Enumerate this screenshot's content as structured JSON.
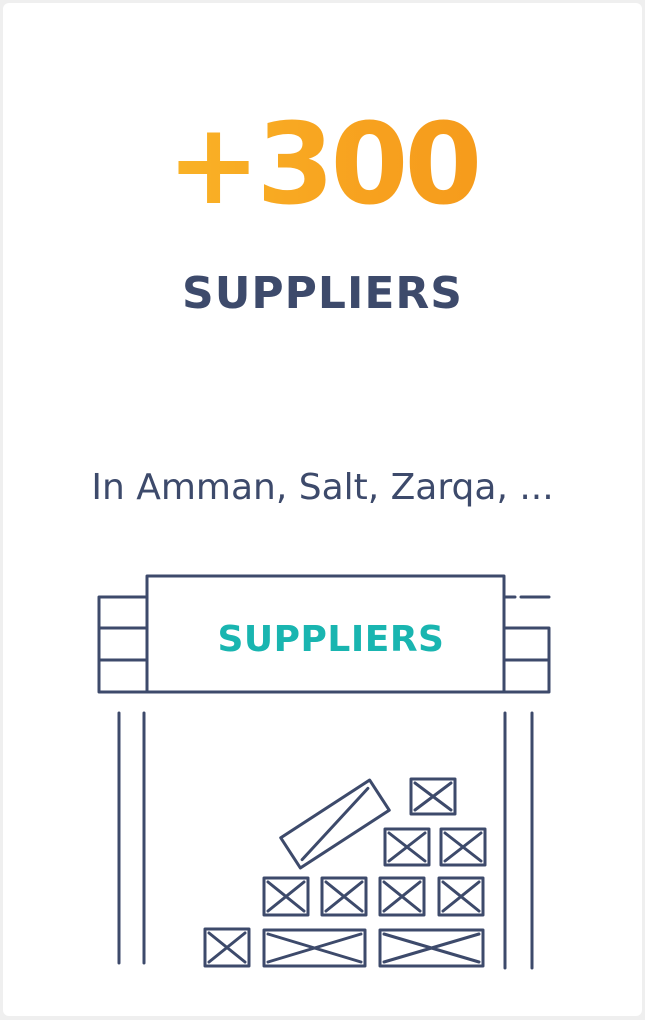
{
  "stat": {
    "count": "+300",
    "label": "SUPPLIERS",
    "locations": "In Amman, Salt, Zarqa, ..."
  },
  "illustration": {
    "sign_text": "SUPPLIERS",
    "icon": "warehouse-with-crates"
  },
  "colors": {
    "accent_start": "#fbc02d",
    "accent_end": "#f39419",
    "heading": "#3d4a6b",
    "sign_text": "#19b5b0",
    "line": "#3d4a6b"
  }
}
